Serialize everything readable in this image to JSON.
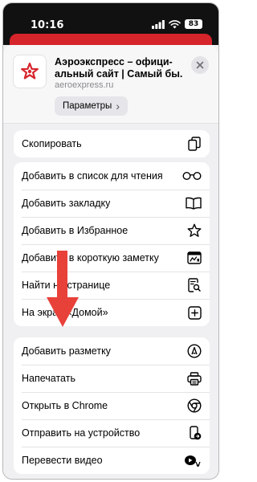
{
  "status_bar": {
    "time": "10:16",
    "battery": "83"
  },
  "header": {
    "title_line1": "Аэроэкспресс – офици-",
    "title_line2": "альный сайт | Самый бы...",
    "url": "aeroexpress.ru",
    "params_label": "Параметры",
    "params_chevron": "›"
  },
  "groups": [
    {
      "items": [
        {
          "label": "Скопировать",
          "icon": "copy-icon"
        }
      ]
    },
    {
      "items": [
        {
          "label": "Добавить в список для чтения",
          "icon": "glasses-icon"
        },
        {
          "label": "Добавить закладку",
          "icon": "book-icon"
        },
        {
          "label": "Добавить в Избранное",
          "icon": "star-icon"
        },
        {
          "label": "Добавить в короткую заметку",
          "icon": "quick-note-icon"
        },
        {
          "label": "Найти на странице",
          "icon": "find-in-page-icon"
        },
        {
          "label": "На экран «Домой»",
          "icon": "add-square-icon"
        }
      ]
    },
    {
      "items": [
        {
          "label": "Добавить разметку",
          "icon": "markup-icon"
        },
        {
          "label": "Напечатать",
          "icon": "printer-icon"
        },
        {
          "label": "Открыть в Chrome",
          "icon": "chrome-icon"
        },
        {
          "label": "Отправить на устройство",
          "icon": "send-to-device-icon"
        },
        {
          "label": "Перевести видео",
          "icon": "translate-video-icon"
        }
      ]
    }
  ],
  "colors": {
    "accent_red": "#d6242b",
    "arrow_red": "#e8413a"
  }
}
